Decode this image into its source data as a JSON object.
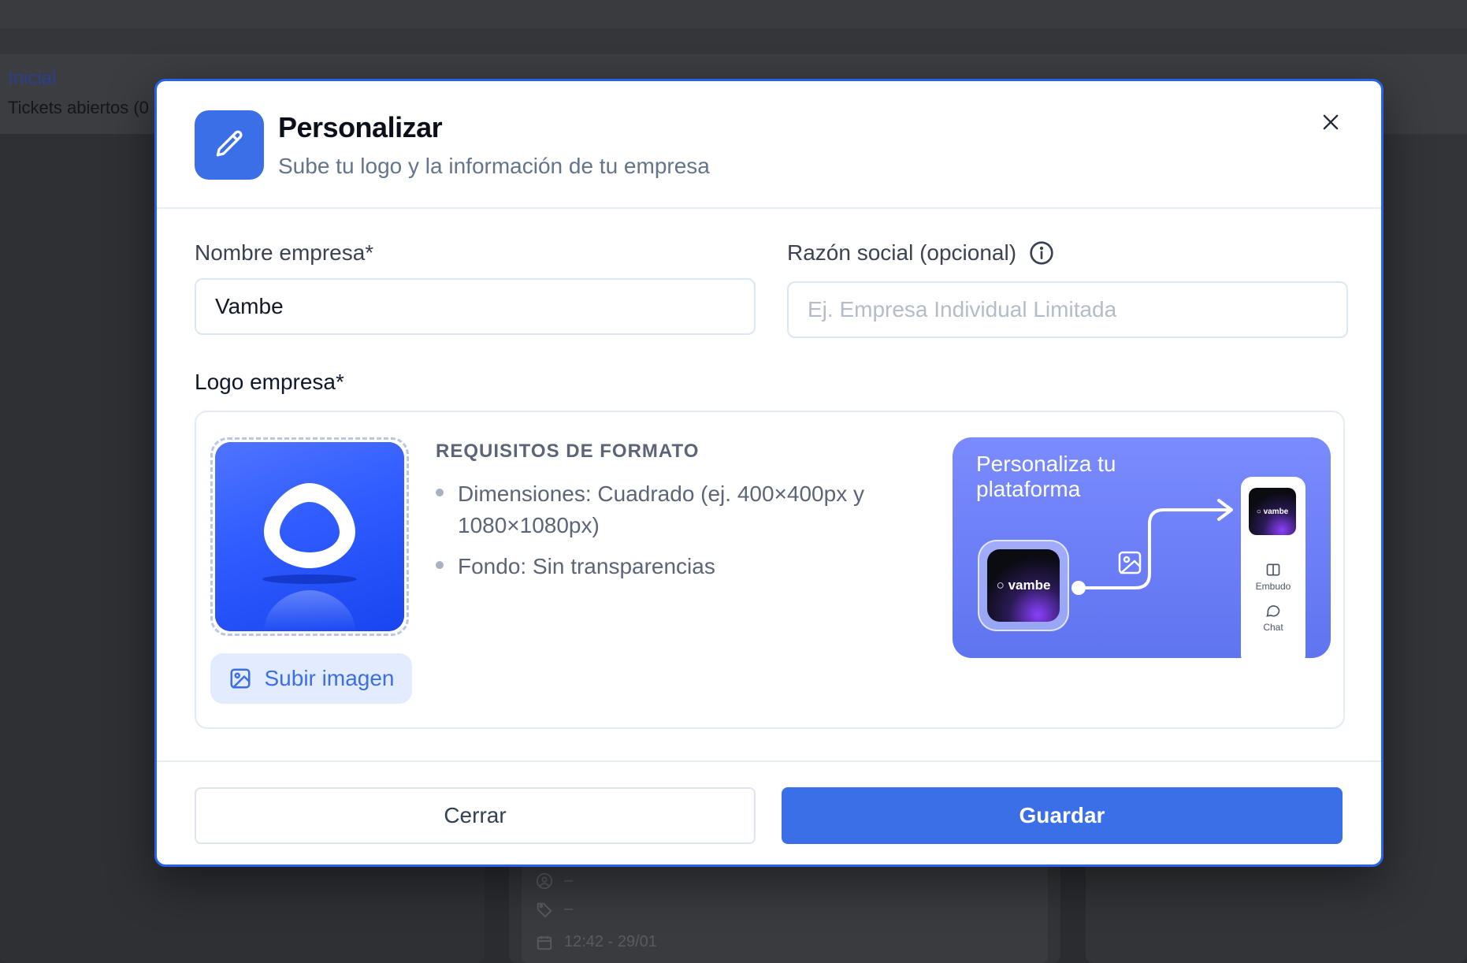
{
  "background": {
    "nav_label": "Inicial",
    "tickets_label": "Tickets abiertos (0",
    "card_meta": [
      "–",
      "–",
      "12:42 - 29/01"
    ]
  },
  "modal": {
    "title": "Personalizar",
    "subtitle": "Sube tu logo y la información de tu empresa",
    "company_name": {
      "label": "Nombre empresa*",
      "value": "Vambe"
    },
    "legal_name": {
      "label": "Razón social (opcional)",
      "placeholder": "Ej. Empresa Individual Limitada"
    },
    "logo": {
      "label": "Logo empresa*",
      "upload_label": "Subir imagen",
      "requirements_title": "REQUISITOS DE FORMATO",
      "requirements": [
        "Dimensiones: Cuadrado (ej. 400×400px y 1080×1080px)",
        "Fondo: Sin transparencias"
      ]
    },
    "promo": {
      "title": "Personaliza tu plataforma",
      "app_name": "vambe",
      "nav_items": [
        "Embudo",
        "Chat"
      ]
    },
    "buttons": {
      "cancel": "Cerrar",
      "save": "Guardar"
    }
  },
  "colors": {
    "accent": "#3b6fe8",
    "modal_border": "#2563eb",
    "overlay": "#2b2c30"
  }
}
